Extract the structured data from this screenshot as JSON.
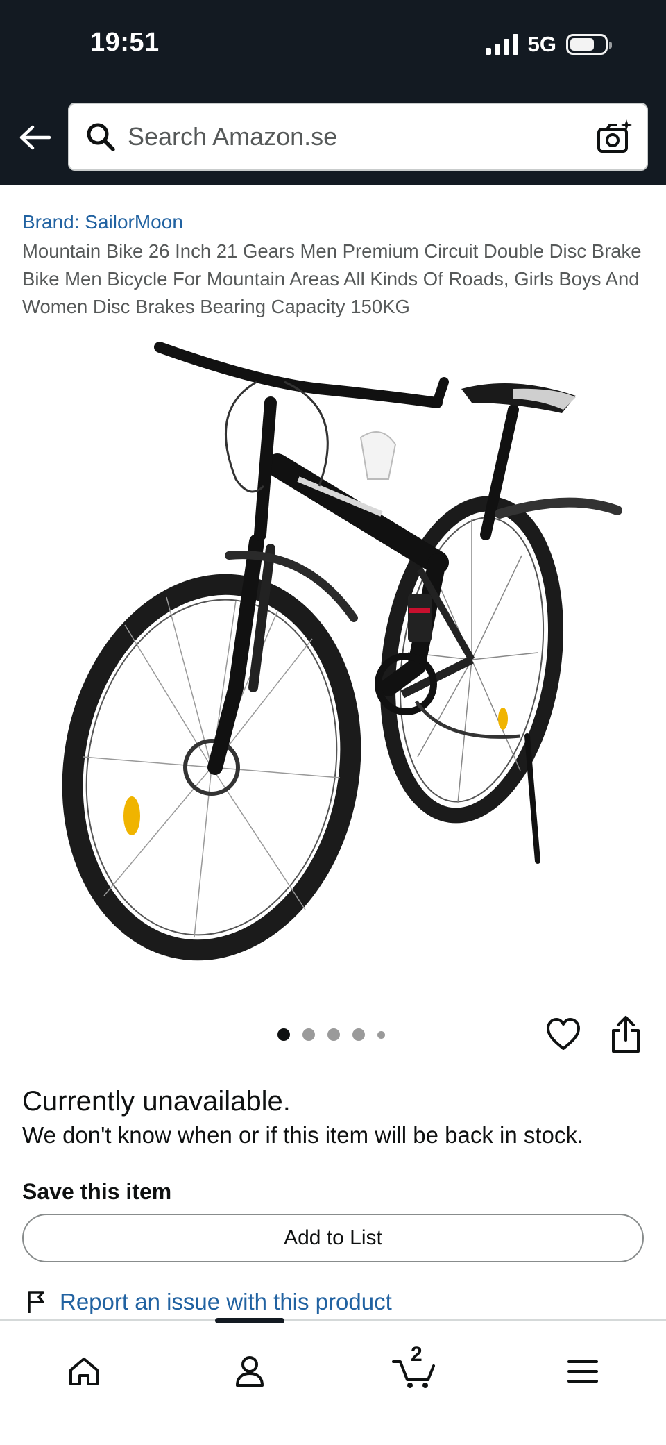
{
  "status_bar": {
    "time": "19:51",
    "network": "5G"
  },
  "search": {
    "placeholder": "Search Amazon.se"
  },
  "product": {
    "brand": "Brand: SailorMoon",
    "title": "Mountain Bike 26 Inch 21 Gears Men Premium Circuit Double Disc Brake Bike Men Bicycle For Mountain Areas All Kinds Of Roads, Girls Boys And Women Disc Brakes Bearing Capacity 150KG",
    "image_count": 5,
    "active_image_index": 0
  },
  "availability": {
    "heading": "Currently unavailable.",
    "message": "We don't know when or if this item will be back in stock."
  },
  "save": {
    "label": "Save this item",
    "button": "Add to List"
  },
  "report": {
    "label": "Report an issue with this product"
  },
  "bottom_nav": {
    "items": [
      "home-icon",
      "account-icon",
      "cart-icon",
      "menu-icon"
    ],
    "cart_count": "2"
  },
  "colors": {
    "header_bg": "#131a22",
    "link": "#2162a1",
    "text": "#0f1111"
  }
}
